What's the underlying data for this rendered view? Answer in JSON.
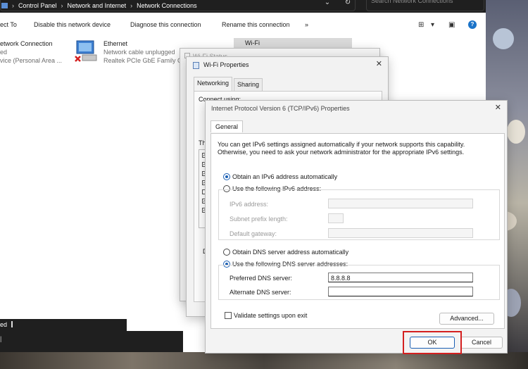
{
  "addressbar": {
    "crumbs": [
      "Control Panel",
      "Network and Internet",
      "Network Connections"
    ],
    "search_placeholder": "Search Network Connections"
  },
  "toolbar": {
    "connect_to": "ect To",
    "disable": "Disable this network device",
    "diagnose": "Diagnose this connection",
    "rename": "Rename this connection",
    "more": "»"
  },
  "adapters": [
    {
      "name": "etwork Connection",
      "line2": "ed",
      "line3": "vice (Personal Area ..."
    },
    {
      "name": "Ethernet",
      "line2": "Network cable unplugged",
      "line3": "Realtek PCIe GbE Family C"
    },
    {
      "name": "Wi-Fi"
    }
  ],
  "statusbar": {
    "text": "ed"
  },
  "wifi_status": {
    "title": "Wi-Fi Status"
  },
  "wifi_props": {
    "title": "Wi-Fi Properties",
    "tabs": [
      "Networking",
      "Sharing"
    ],
    "connect_using": "Connect using:",
    "this_conn": "Th",
    "d_label": "D"
  },
  "ipv6": {
    "title": "Internet Protocol Version 6 (TCP/IPv6) Properties",
    "tab": "General",
    "intro": "You can get IPv6 settings assigned automatically if your network supports this capability. Otherwise, you need to ask your network administrator for the appropriate IPv6 settings.",
    "obtain_auto": "Obtain an IPv6 address automatically",
    "use_following": "Use the following IPv6 address:",
    "ipv6_address": "IPv6 address:",
    "subnet_prefix": "Subnet prefix length:",
    "default_gateway": "Default gateway:",
    "obtain_dns_auto": "Obtain DNS server address automatically",
    "use_dns": "Use the following DNS server addresses:",
    "preferred_dns": "Preferred DNS server:",
    "preferred_dns_value": "8.8.8.8",
    "alternate_dns": "Alternate DNS server:",
    "alternate_dns_value": "",
    "validate": "Validate settings upon exit",
    "advanced": "Advanced...",
    "ok": "OK",
    "cancel": "Cancel",
    "selected_ip_mode": "auto",
    "selected_dns_mode": "manual",
    "validate_checked": false
  },
  "colors": {
    "highlight": "#d42020",
    "radio_accent": "#1a5fb4",
    "dark_bar": "#1f1f1f"
  }
}
